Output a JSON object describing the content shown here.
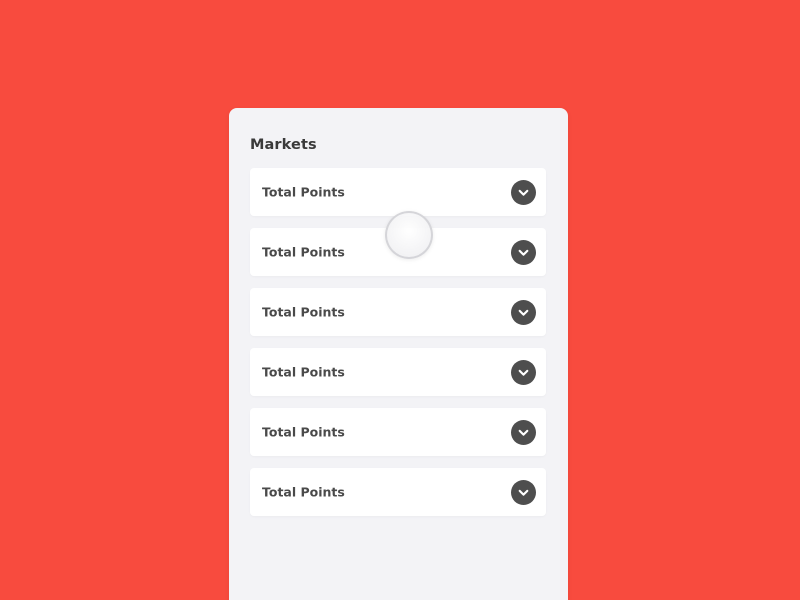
{
  "colors": {
    "background": "#f84b3e",
    "panel": "#f3f3f6",
    "card": "#ffffff",
    "chevron_button": "#4e4e4e",
    "text": "#4a4a4a"
  },
  "markets": {
    "title": "Markets",
    "items": [
      {
        "label": "Total Points",
        "icon": "chevron-down-icon"
      },
      {
        "label": "Total Points",
        "icon": "chevron-down-icon"
      },
      {
        "label": "Total Points",
        "icon": "chevron-down-icon"
      },
      {
        "label": "Total Points",
        "icon": "chevron-down-icon"
      },
      {
        "label": "Total Points",
        "icon": "chevron-down-icon"
      },
      {
        "label": "Total Points",
        "icon": "chevron-down-icon"
      }
    ]
  }
}
